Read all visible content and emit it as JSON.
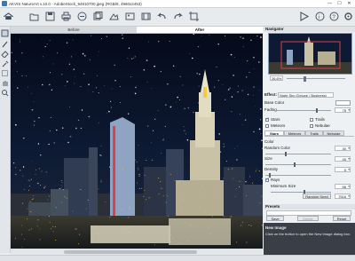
{
  "window": {
    "title": "AKVIS NatureArt v.10.0 - AdobeStock_94810700.jpeg (RGB/8, 4960x2453)",
    "min_glyph": "—",
    "max_glyph": "☐",
    "close_glyph": "✕"
  },
  "toolbar": {
    "icons": [
      "home-icon",
      "open-file-icon",
      "save-icon",
      "print-icon",
      "share-icon",
      "batch-icon",
      "presets-icon",
      "undo-icon",
      "redo-icon",
      "back-icon",
      "forward-icon",
      "hand-icon",
      "run-icon",
      "about-icon",
      "help-icon",
      "settings-icon"
    ]
  },
  "canvas": {
    "tab_before": "Before",
    "tab_after": "After"
  },
  "navigator": {
    "title": "Navigator",
    "zoom": "26.6%"
  },
  "effect": {
    "label": "Effect:",
    "selected": "Night Sky (Deluxe / Business)",
    "base_color_label": "Base Color",
    "fading_label": "Fading",
    "fading_value": "75",
    "fading_level": 0.75
  },
  "checks": {
    "stars": "Stars",
    "trails": "Trails",
    "meteors": "Meteors",
    "nebulae": "Nebulae",
    "stars_checked": true,
    "trails_checked": false,
    "meteors_checked": false,
    "nebulae_checked": false
  },
  "subtabs": [
    "Stars",
    "Meteors",
    "Trails",
    "Nebulae"
  ],
  "stars": {
    "color_label": "Color",
    "random_color_label": "Random Color",
    "random_color_value": "30",
    "random_color_level": 0.3,
    "size_label": "Size",
    "size_value": "45",
    "size_level": 0.45,
    "density_label": "Density",
    "density_value": "5",
    "density_level": 0.05,
    "rays_label": "Rays",
    "rays_checked": true,
    "min_size_label": "Minimum Size",
    "min_size_value": "56",
    "min_size_level": 0.56,
    "random_seed_label": "Random Seed",
    "random_seed_value": "7516"
  },
  "presets": {
    "title": "Presets",
    "save_label": "Save",
    "delete_label": "Delete",
    "reset_label": "Reset"
  },
  "new_image": {
    "heading": "New Image",
    "text": "Click on the button to open the New Image dialog box."
  },
  "colors": {
    "sky": "#0d1a33",
    "accent": "#1a4e8a",
    "panel_bg": "#eef1f4"
  }
}
